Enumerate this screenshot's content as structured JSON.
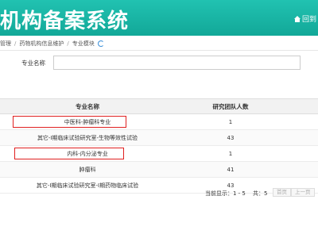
{
  "header": {
    "title": "机构备案系统",
    "back_label": "回到",
    "back_icon": "home-icon",
    "colors": {
      "bg": "#16b2a2",
      "text": "#ffffff"
    }
  },
  "breadcrumb": {
    "items": [
      "管理",
      "药物机构信息维护",
      "专业模块"
    ],
    "refresh_icon": "refresh-icon"
  },
  "search": {
    "label": "专业名称",
    "value": ""
  },
  "table": {
    "headers": [
      "专业名称",
      "研究团队人数"
    ],
    "rows": [
      {
        "name": "中医科-肿瘤科专业",
        "count": "1",
        "highlighted": true
      },
      {
        "name": "其它-Ⅰ期临床试验研究室-生物等效性试验",
        "count": "43",
        "highlighted": false
      },
      {
        "name": "内科-内分泌专业",
        "count": "1",
        "highlighted": true
      },
      {
        "name": "肿瘤科",
        "count": "41",
        "highlighted": false
      },
      {
        "name": "其它-Ⅰ期临床试验研究室-Ⅰ期药物临床试验",
        "count": "43",
        "highlighted": false
      }
    ]
  },
  "pager": {
    "current_label": "当前显示：1 - 5",
    "total_label": "共：5",
    "first_label": "首页",
    "prev_label": "上一页"
  },
  "accent": {
    "highlight_border": "#e02020"
  }
}
